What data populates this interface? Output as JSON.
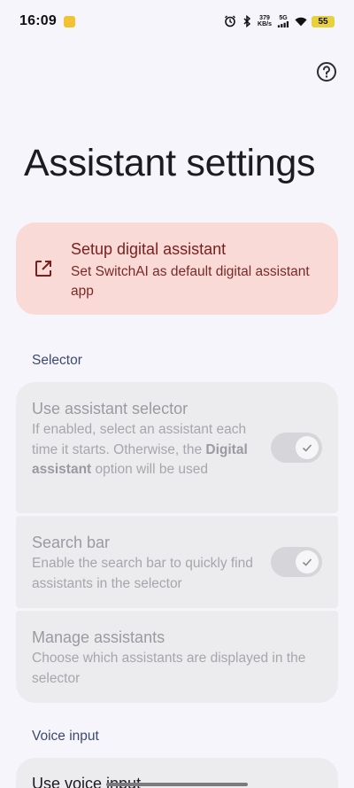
{
  "status_bar": {
    "time": "16:09",
    "net_speed_value": "379",
    "net_speed_unit": "KB/s",
    "network_type": "5G",
    "battery": "55"
  },
  "page": {
    "title": "Assistant settings"
  },
  "setup_card": {
    "title": "Setup digital assistant",
    "description": "Set SwitchAI as default digital assistant app",
    "icon": "open-external-icon",
    "color": "#fadad7"
  },
  "selector_section": {
    "header": "Selector",
    "use_selector": {
      "title": "Use assistant selector",
      "desc_part1": "If enabled, select an assistant each time it starts. Otherwise, the ",
      "desc_bold": "Digital assistant",
      "desc_part2": " option will be used",
      "toggle_on": true
    },
    "search_bar": {
      "title": "Search bar",
      "description": "Enable the search bar to quickly find assistants in the selector",
      "toggle_on": true
    },
    "manage": {
      "title": "Manage assistants",
      "description": "Choose which assistants are displayed in the selector"
    }
  },
  "voice_section": {
    "header": "Voice input",
    "use_voice": {
      "title": "Use voice input"
    }
  }
}
